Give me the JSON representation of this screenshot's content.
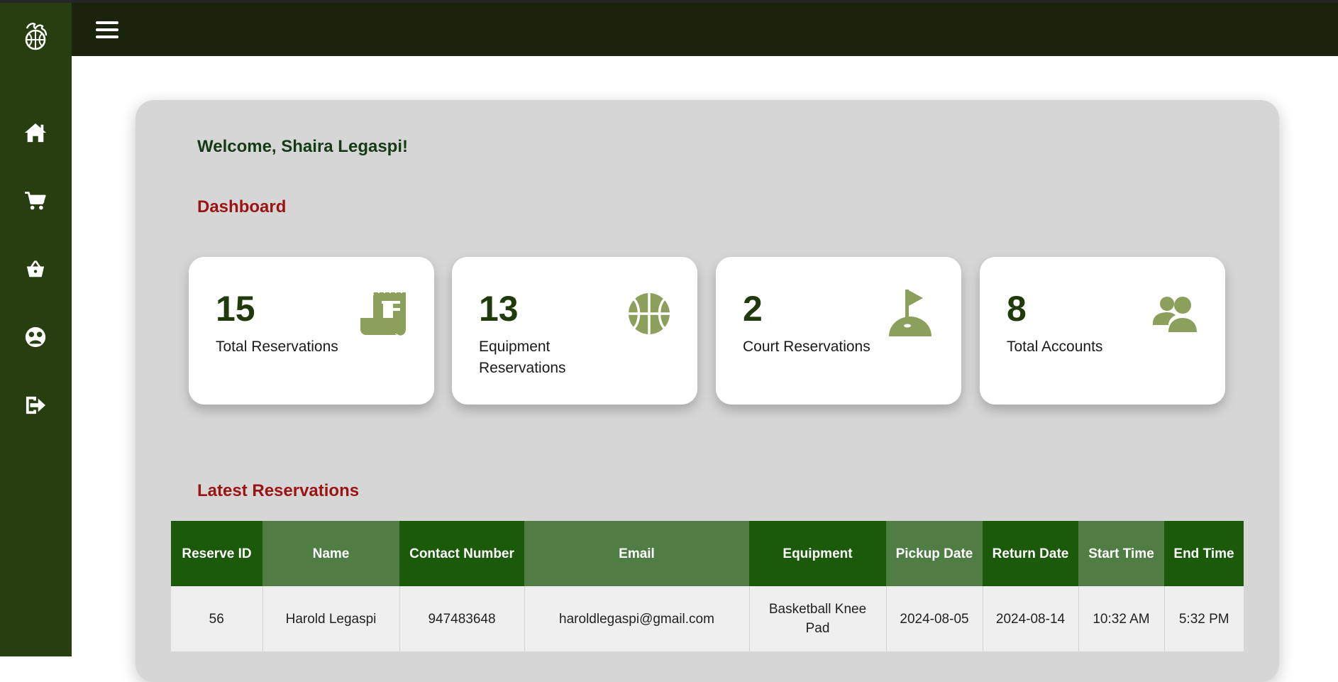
{
  "welcome": "Welcome, Shaira Legaspi!",
  "dashboard_title": "Dashboard",
  "stats": [
    {
      "value": "15",
      "label": "Total Reservations",
      "icon": "receipt-icon"
    },
    {
      "value": "13",
      "label": "Equipment Reservations",
      "icon": "basketball-icon"
    },
    {
      "value": "2",
      "label": "Court Reservations",
      "icon": "golf-flag-icon"
    },
    {
      "value": "8",
      "label": "Total Accounts",
      "icon": "users-icon"
    }
  ],
  "latest_title": "Latest Reservations",
  "table": {
    "headers": [
      "Reserve ID",
      "Name",
      "Contact Number",
      "Email",
      "Equipment",
      "Pickup Date",
      "Return Date",
      "Start Time",
      "End Time"
    ],
    "rows": [
      [
        "56",
        "Harold Legaspi",
        "947483648",
        "haroldlegaspi@gmail.com",
        "Basketball Knee Pad",
        "2024-08-05",
        "2024-08-14",
        "10:32 AM",
        "5:32 PM"
      ]
    ]
  },
  "sidebar_icons": [
    "home-icon",
    "cart-icon",
    "basket-icon",
    "user-circle-icon",
    "logout-icon"
  ],
  "colors": {
    "sidebar": "#263e10",
    "topbar": "#1a230b",
    "accent_red": "#9b1414",
    "icon_olive": "#8d9f5c",
    "header_dark_green": "#1c5a0b",
    "header_light_green": "#4f7d43"
  }
}
